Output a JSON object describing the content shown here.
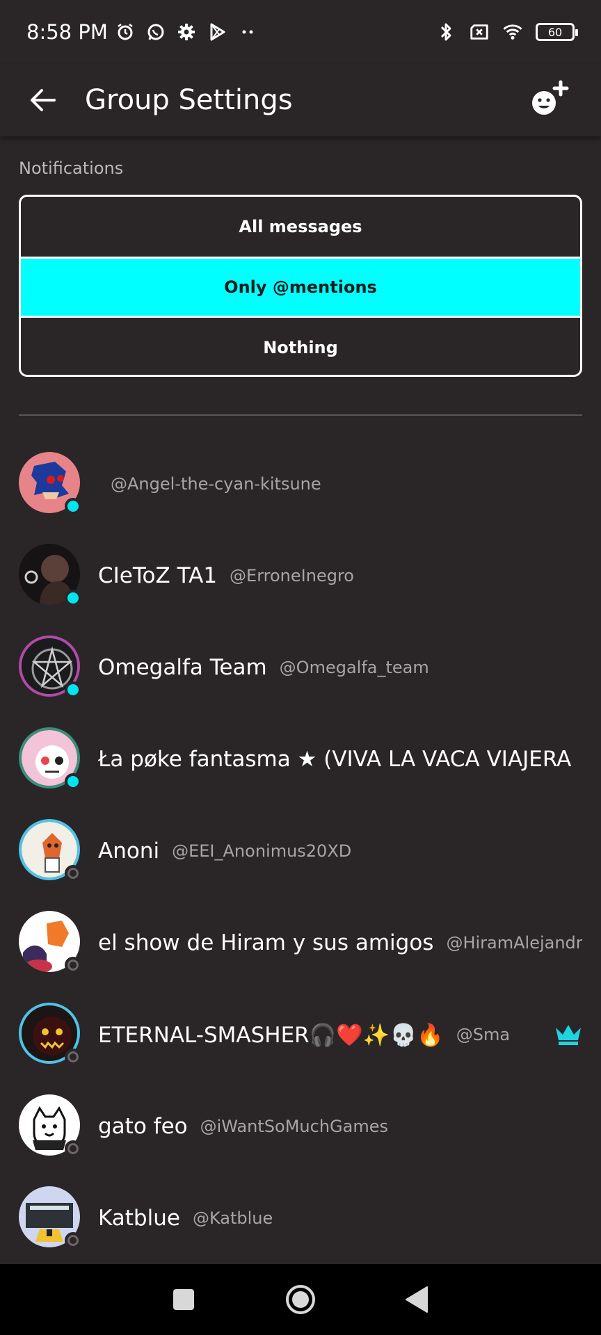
{
  "status_bar": {
    "time": "8:58 PM",
    "battery": "60"
  },
  "app_bar": {
    "title": "Group Settings"
  },
  "notifications": {
    "label": "Notifications",
    "options": [
      {
        "label": "All messages",
        "selected": false
      },
      {
        "label": "Only @mentions",
        "selected": true
      },
      {
        "label": "Nothing",
        "selected": false
      }
    ]
  },
  "members": [
    {
      "name": "",
      "handle": "@Angel-the-cyan-kitsune",
      "status": "online"
    },
    {
      "name": "CIeToZ TA1",
      "handle": "@ErroneInegro",
      "status": "online"
    },
    {
      "name": "Omegalfa Team",
      "handle": "@Omegalfa_team",
      "status": "online"
    },
    {
      "name": "Ła pøke fantasma ★ (VIVA LA VACA VIAJERA",
      "handle": "",
      "status": "online"
    },
    {
      "name": "Anoni",
      "handle": "@EEI_Anonimus20XD",
      "status": "offline"
    },
    {
      "name": "el show de Hiram y sus amigos",
      "handle": "@HiramAlejandr",
      "status": "offline"
    },
    {
      "name": "ETERNAL-SMASHER🎧❤️✨💀🔥",
      "handle": "@Sma",
      "status": "offline",
      "crown": true
    },
    {
      "name": "gato feo",
      "handle": "@iWantSoMuchGames",
      "status": "offline"
    },
    {
      "name": "Katblue",
      "handle": "@Katblue",
      "status": "offline"
    }
  ],
  "colors": {
    "accent": "#00ffff",
    "background": "#2a2627",
    "online": "#00e5f0"
  }
}
